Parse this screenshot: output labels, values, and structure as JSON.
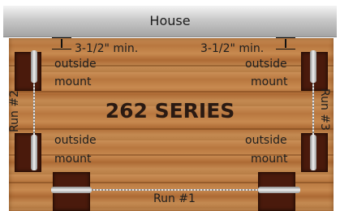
{
  "house_label": "House",
  "title": "262 SERIES",
  "clearance_left": "3-1/2\" min.",
  "clearance_right": "3-1/2\" min.",
  "mount_labels": {
    "top_left": [
      "outside",
      "mount"
    ],
    "top_right": [
      "outside",
      "mount"
    ],
    "bottom_left": [
      "outside",
      "mount"
    ],
    "bottom_right": [
      "outside",
      "mount"
    ]
  },
  "runs": {
    "run1": "Run #1",
    "run2": "Run #2",
    "run3": "Run #3"
  }
}
